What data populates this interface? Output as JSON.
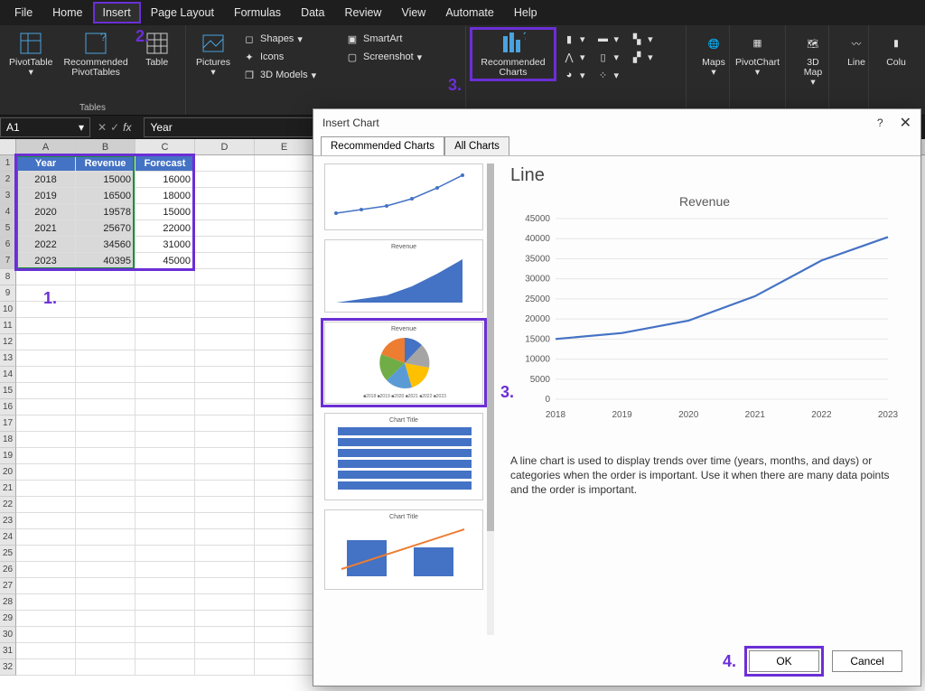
{
  "menu": {
    "items": [
      "File",
      "Home",
      "Insert",
      "Page Layout",
      "Formulas",
      "Data",
      "Review",
      "View",
      "Automate",
      "Help"
    ],
    "active_index": 2
  },
  "ribbon": {
    "tables": {
      "label": "Tables",
      "pivot": "PivotTable",
      "recpivot": "Recommended\nPivotTables",
      "table": "Table"
    },
    "illus": {
      "pictures": "Pictures",
      "shapes": "Shapes",
      "icons": "Icons",
      "models": "3D Models",
      "smartart": "SmartArt",
      "screenshot": "Screenshot"
    },
    "charts": {
      "recommended": "Recommended\nCharts"
    },
    "maps": "Maps",
    "pivotchart": "PivotChart",
    "map3d": "3D\nMap",
    "line": "Line",
    "colu": "Colu"
  },
  "steps": {
    "s1": "1.",
    "s2": "2.",
    "s3": "3.",
    "s3b": "3.",
    "s4": "4."
  },
  "namebox": "A1",
  "formula": "Year",
  "sheet": {
    "cols": [
      "A",
      "B",
      "C",
      "D",
      "E"
    ],
    "headers": [
      "Year",
      "Revenue",
      "Forecast"
    ],
    "rows": [
      {
        "y": "2018",
        "r": "15000",
        "f": "16000"
      },
      {
        "y": "2019",
        "r": "16500",
        "f": "18000"
      },
      {
        "y": "2020",
        "r": "19578",
        "f": "15000"
      },
      {
        "y": "2021",
        "r": "25670",
        "f": "22000"
      },
      {
        "y": "2022",
        "r": "34560",
        "f": "31000"
      },
      {
        "y": "2023",
        "r": "40395",
        "f": "45000"
      }
    ]
  },
  "dialog": {
    "title": "Insert Chart",
    "help": "?",
    "tabs": {
      "rec": "Recommended Charts",
      "all": "All Charts"
    },
    "thumbs": {
      "t2": "Revenue",
      "t3": "Revenue",
      "t4": "Chart Title",
      "t5": "Chart Title",
      "pie_legend": [
        "2018",
        "2019",
        "2020",
        "2021",
        "2022",
        "2023"
      ]
    },
    "preview": {
      "type": "Line",
      "title": "Revenue",
      "desc": "A line chart is used to display trends over time (years, months, and days) or categories when the order is important. Use it when there are many data points and the order is important."
    },
    "ok": "OK",
    "cancel": "Cancel"
  },
  "chart_data": {
    "type": "line",
    "title": "Revenue",
    "xlabel": "",
    "ylabel": "",
    "categories": [
      "2018",
      "2019",
      "2020",
      "2021",
      "2022",
      "2023"
    ],
    "series": [
      {
        "name": "Revenue",
        "values": [
          15000,
          16500,
          19578,
          25670,
          34560,
          40395
        ]
      }
    ],
    "ylim": [
      0,
      45000
    ],
    "yticks": [
      0,
      5000,
      10000,
      15000,
      20000,
      25000,
      30000,
      35000,
      40000,
      45000
    ]
  }
}
